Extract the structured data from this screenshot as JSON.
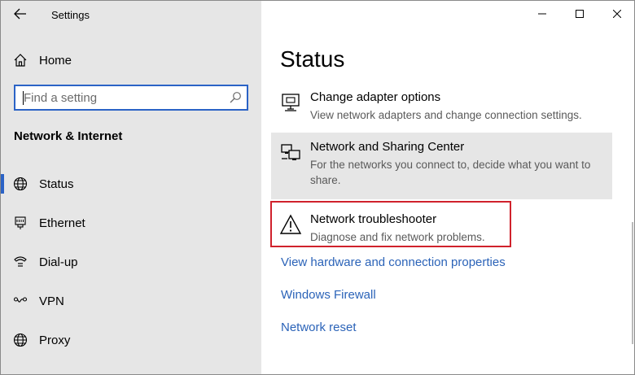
{
  "window": {
    "app_title": "Settings"
  },
  "sidebar": {
    "home_label": "Home",
    "search": {
      "placeholder": "Find a setting",
      "value": ""
    },
    "section_header": "Network & Internet",
    "items": [
      {
        "label": "Status",
        "icon": "globe-icon",
        "selected": true
      },
      {
        "label": "Ethernet",
        "icon": "ethernet-icon",
        "selected": false
      },
      {
        "label": "Dial-up",
        "icon": "dial-up-icon",
        "selected": false
      },
      {
        "label": "VPN",
        "icon": "vpn-icon",
        "selected": false
      },
      {
        "label": "Proxy",
        "icon": "globe-icon",
        "selected": false
      }
    ]
  },
  "main": {
    "title": "Status",
    "options": [
      {
        "title": "Change adapter options",
        "description": "View network adapters and change connection settings.",
        "icon": "adapter-icon"
      },
      {
        "title": "Network and Sharing Center",
        "description": "For the networks you connect to, decide what you want to share.",
        "icon": "sharing-center-icon"
      },
      {
        "title": "Network troubleshooter",
        "description": "Diagnose and fix network problems.",
        "icon": "warning-icon"
      }
    ],
    "links": [
      "View hardware and connection properties",
      "Windows Firewall",
      "Network reset"
    ]
  },
  "colors": {
    "sidebar_bg": "#e6e6e6",
    "accent": "#2b63c6",
    "link": "#2b63b8",
    "highlight_border": "#d0222c"
  }
}
